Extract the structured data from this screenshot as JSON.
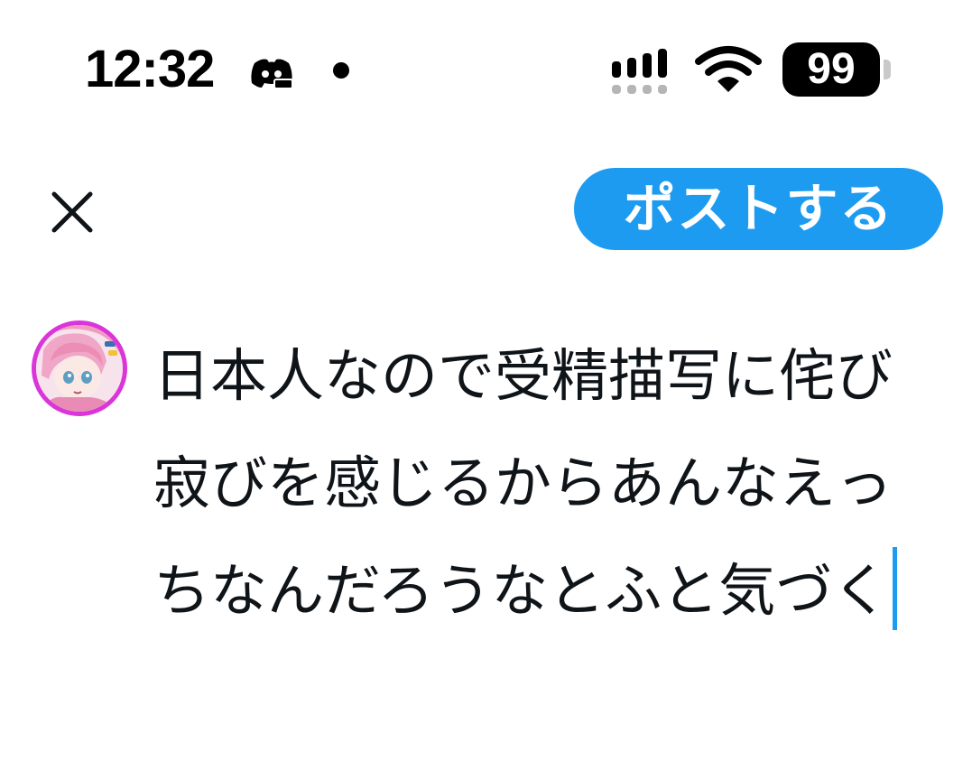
{
  "status_bar": {
    "time": "12:32",
    "battery_level": "99"
  },
  "compose": {
    "post_label": "ポストする",
    "text": "日本人なので受精描写に侘び寂びを感じるからあんなえっちなんだろうなとふと気づく"
  },
  "icons": {
    "close": "close-icon",
    "discord": "discord-icon",
    "signal": "signal-icon",
    "wifi": "wifi-icon"
  },
  "colors": {
    "accent": "#1d9bf0",
    "avatar_ring": "#d935d9",
    "text": "#0f1419"
  }
}
